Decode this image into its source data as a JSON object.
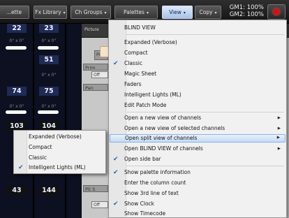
{
  "toolbar": {
    "buttons": [
      {
        "label": "...ette"
      },
      {
        "label": "Fx Library"
      },
      {
        "label": "Ch Groups"
      },
      {
        "label": "Palettes"
      },
      {
        "label": "View"
      },
      {
        "label": "Copy"
      }
    ],
    "gm1": "GM1: 100%",
    "gm2": "GM2: 100%",
    "record_color": "#c81616"
  },
  "channels": {
    "size_label": "0° x 0°",
    "rows": [
      [
        "22",
        "23"
      ],
      [
        "",
        "51"
      ],
      [
        "74",
        "75"
      ],
      [
        "103",
        "104"
      ],
      [
        "43",
        "144"
      ]
    ]
  },
  "panel": {
    "label": "Picture",
    "fragments": [
      "Pr",
      "Prim",
      "Pan",
      "Off",
      "Pit S",
      "Off"
    ]
  },
  "menu": {
    "header": "BLIND VIEW",
    "items": [
      {
        "label": "Expanded (Verbose)",
        "checked": false,
        "submenu": false
      },
      {
        "label": "Compact",
        "checked": false,
        "submenu": false
      },
      {
        "label": "Classic",
        "checked": true,
        "submenu": false
      },
      {
        "label": "Magic Sheet",
        "checked": false,
        "submenu": false
      },
      {
        "label": "Faders",
        "checked": false,
        "submenu": false
      },
      {
        "label": "Intelligent Lights (ML)",
        "checked": false,
        "submenu": false
      },
      {
        "label": "Edit Patch Mode",
        "checked": false,
        "submenu": false
      },
      {
        "label": "Open a new view of channels",
        "checked": false,
        "submenu": true
      },
      {
        "label": "Open a new view of selected channels",
        "checked": false,
        "submenu": true
      },
      {
        "label": "Open split view of channels",
        "checked": false,
        "submenu": true,
        "highlighted": true
      },
      {
        "label": "Open BLIND VIEW of channels",
        "checked": false,
        "submenu": true
      },
      {
        "label": "Open side bar",
        "checked": true,
        "submenu": false
      },
      {
        "label": "Show palette information",
        "checked": true,
        "submenu": false
      },
      {
        "label": "Enter the column count",
        "checked": false,
        "submenu": false
      },
      {
        "label": "Show 3rd line of text",
        "checked": false,
        "submenu": false
      },
      {
        "label": "Show Clock",
        "checked": true,
        "submenu": false
      },
      {
        "label": "Show Timecode",
        "checked": false,
        "submenu": false
      }
    ]
  },
  "submenu": {
    "items": [
      {
        "label": "Expanded (Verbose)",
        "checked": false
      },
      {
        "label": "Compact",
        "checked": false
      },
      {
        "label": "Classic",
        "checked": false
      },
      {
        "label": "Intelligent Lights (ML)",
        "checked": true
      }
    ]
  },
  "colors": {
    "highlight_border": "#8cb2e3",
    "check": "#2a62b8",
    "view_button": "#a9c2e6"
  }
}
